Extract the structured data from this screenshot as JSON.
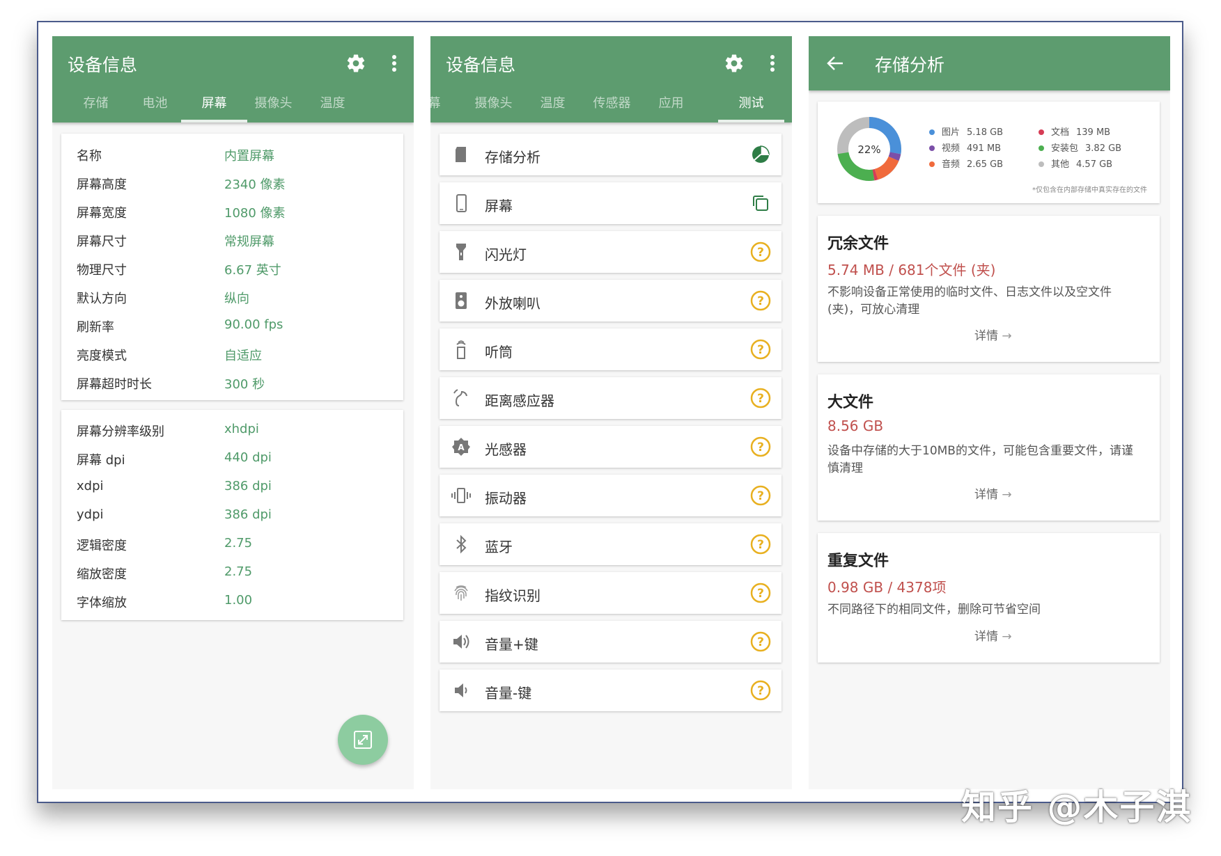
{
  "panel1": {
    "title": "设备信息",
    "tabs": [
      "存储",
      "电池",
      "屏幕",
      "摄像头",
      "温度"
    ],
    "active_tab": 2,
    "display_section": [
      {
        "label": "名称",
        "value": "内置屏幕"
      },
      {
        "label": "屏幕高度",
        "value": "2340 像素"
      },
      {
        "label": "屏幕宽度",
        "value": "1080 像素"
      },
      {
        "label": "屏幕尺寸",
        "value": "常规屏幕"
      },
      {
        "label": "物理尺寸",
        "value": "6.67  英寸"
      },
      {
        "label": "默认方向",
        "value": "纵向"
      },
      {
        "label": "刷新率",
        "value": "90.00 fps"
      },
      {
        "label": "亮度模式",
        "value": "自适应"
      },
      {
        "label": "屏幕超时时长",
        "value": "300 秒"
      }
    ],
    "density_section": [
      {
        "label": "屏幕分辨率级别",
        "value": "xhdpi"
      },
      {
        "label": "屏幕 dpi",
        "value": "440 dpi"
      },
      {
        "label": "xdpi",
        "value": "386 dpi"
      },
      {
        "label": "ydpi",
        "value": "386 dpi"
      },
      {
        "label": "逻辑密度",
        "value": "2.75"
      },
      {
        "label": "缩放密度",
        "value": "2.75"
      },
      {
        "label": "字体缩放",
        "value": "1.00"
      }
    ]
  },
  "panel2": {
    "title": "设备信息",
    "tabs": [
      "幕",
      "摄像头",
      "温度",
      "传感器",
      "应用",
      "测试"
    ],
    "active_tab": 5,
    "tests": [
      {
        "label": "存储分析",
        "icon": "sd-card-icon",
        "status": "pie-chart-icon"
      },
      {
        "label": "屏幕",
        "icon": "phone-icon",
        "status": "copy-icon"
      },
      {
        "label": "闪光灯",
        "icon": "flashlight-icon",
        "status": "help-icon"
      },
      {
        "label": "外放喇叭",
        "icon": "speaker-icon",
        "status": "help-icon"
      },
      {
        "label": "听筒",
        "icon": "earpiece-icon",
        "status": "help-icon"
      },
      {
        "label": "距离感应器",
        "icon": "proximity-icon",
        "status": "help-icon"
      },
      {
        "label": "光感器",
        "icon": "light-sensor-icon",
        "status": "help-icon"
      },
      {
        "label": "振动器",
        "icon": "vibration-icon",
        "status": "help-icon"
      },
      {
        "label": "蓝牙",
        "icon": "bluetooth-icon",
        "status": "help-icon"
      },
      {
        "label": "指纹识别",
        "icon": "fingerprint-icon",
        "status": "help-icon"
      },
      {
        "label": "音量+键",
        "icon": "volume-up-icon",
        "status": "help-icon"
      },
      {
        "label": "音量-键",
        "icon": "volume-down-icon",
        "status": "help-icon"
      }
    ]
  },
  "panel3": {
    "title": "存储分析",
    "chart_center": "22%",
    "legend": [
      {
        "name": "图片",
        "value": "5.18 GB",
        "color": "#4a90d9"
      },
      {
        "name": "视频",
        "value": "491 MB",
        "color": "#7b4fa8"
      },
      {
        "name": "音频",
        "value": "2.65 GB",
        "color": "#f06a3c"
      },
      {
        "name": "文档",
        "value": "139 MB",
        "color": "#d63c55"
      },
      {
        "name": "安装包",
        "value": "3.82 GB",
        "color": "#4caf50"
      },
      {
        "name": "其他",
        "value": "4.57 GB",
        "color": "#bdbdbd"
      }
    ],
    "footnote": "*仅包含在内部存储中真实存在的文件",
    "cards": [
      {
        "title": "冗余文件",
        "metric": "5.74 MB / 681个文件 (夹)",
        "desc": "不影响设备正常使用的临时文件、日志文件以及空文件(夹)，可放心清理",
        "more": "详情"
      },
      {
        "title": "大文件",
        "metric": "8.56 GB",
        "desc": "设备中存储的大于10MB的文件，可能包含重要文件，请谨慎清理",
        "more": "详情"
      },
      {
        "title": "重复文件",
        "metric": "0.98 GB / 4378项",
        "desc": "不同路径下的相同文件，删除可节省空间",
        "more": "详情"
      }
    ]
  },
  "watermark": "知乎 @木子淇",
  "colors": {
    "primary": "#5d9c6f",
    "value_green": "#4f9a69",
    "metric_red": "#c0504d",
    "help_amber": "#e8b020",
    "fab": "#8dcca0"
  }
}
